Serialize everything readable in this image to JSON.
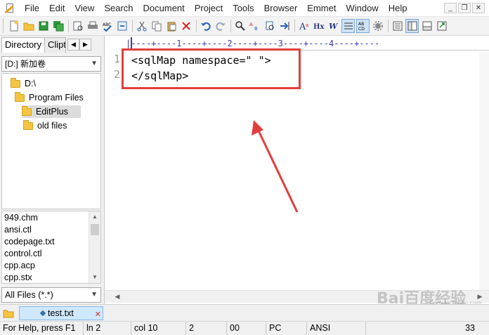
{
  "menu": {
    "items": [
      "File",
      "Edit",
      "View",
      "Search",
      "Document",
      "Project",
      "Tools",
      "Browser",
      "Emmet",
      "Window",
      "Help"
    ]
  },
  "window_controls": {
    "minimize": "_",
    "restore": "❐",
    "close": "✕"
  },
  "toolbar": {
    "icons": [
      "new-file-icon",
      "open-folder-icon",
      "save-icon",
      "save-all-icon",
      "print-preview-icon",
      "print-icon",
      "spell-check-icon",
      "browser-preview-icon",
      "cut-icon",
      "copy-icon",
      "paste-icon",
      "delete-icon",
      "undo-icon",
      "redo-icon",
      "find-icon",
      "replace-icon",
      "find-in-files-icon",
      "goto-icon",
      "font-icon",
      "hx-icon",
      "word-wrap-icon",
      "ruler-icon",
      "column-select-icon",
      "settings-icon",
      "line-number-icon",
      "directory-window-icon",
      "output-window-icon",
      "fullscreen-icon"
    ]
  },
  "left_panel": {
    "tab_directory": "Directory",
    "tab_clip": "Clipt",
    "drive": "[D:] 新加卷",
    "tree": [
      {
        "label": "D:\\",
        "selected": false
      },
      {
        "label": "Program Files",
        "selected": false
      },
      {
        "label": "EditPlus",
        "selected": true
      },
      {
        "label": "old files",
        "selected": false
      }
    ],
    "files": [
      "949.chm",
      "ansi.ctl",
      "codepage.txt",
      "control.ctl",
      "cpp.acp",
      "cpp.stx"
    ],
    "filter": "All Files (*.*)"
  },
  "editor": {
    "ruler": "|----+----1----+----2----+----3----+----4----+----",
    "line_numbers": [
      "1",
      "2"
    ],
    "lines": [
      "<sqlMap namespace=\" \">",
      "</sqlMap>"
    ],
    "highlight_color": "#e23d3d"
  },
  "doc_tab": {
    "label": "test.txt",
    "close": "✕"
  },
  "status": {
    "help": "For Help, press F1",
    "line": "ln 2",
    "col": "col 10",
    "lines": "2",
    "hex": "00",
    "mode": "PC",
    "encoding": "ANSI",
    "count": "33"
  },
  "watermark": {
    "text": "Bai百度经验",
    "sub": "jingyan.baidu.com"
  }
}
